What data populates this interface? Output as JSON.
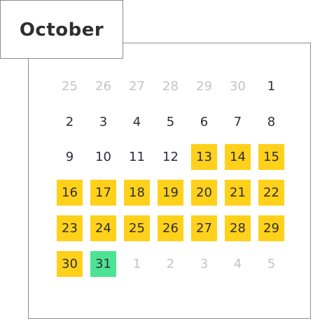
{
  "calendar": {
    "month": "October",
    "colors": {
      "range_highlight": "#ffd11a",
      "today_highlight": "#4de394",
      "outside_text": "#c4c4c8",
      "text": "#2e2e3a"
    },
    "weeks": [
      [
        {
          "day": "25",
          "state": "outside"
        },
        {
          "day": "26",
          "state": "outside"
        },
        {
          "day": "27",
          "state": "outside"
        },
        {
          "day": "28",
          "state": "outside"
        },
        {
          "day": "29",
          "state": "outside"
        },
        {
          "day": "30",
          "state": "outside"
        },
        {
          "day": "1",
          "state": "normal"
        }
      ],
      [
        {
          "day": "2",
          "state": "normal"
        },
        {
          "day": "3",
          "state": "normal"
        },
        {
          "day": "4",
          "state": "normal"
        },
        {
          "day": "5",
          "state": "normal"
        },
        {
          "day": "6",
          "state": "normal"
        },
        {
          "day": "7",
          "state": "normal"
        },
        {
          "day": "8",
          "state": "normal"
        }
      ],
      [
        {
          "day": "9",
          "state": "normal"
        },
        {
          "day": "10",
          "state": "normal"
        },
        {
          "day": "11",
          "state": "normal"
        },
        {
          "day": "12",
          "state": "normal"
        },
        {
          "day": "13",
          "state": "range"
        },
        {
          "day": "14",
          "state": "range"
        },
        {
          "day": "15",
          "state": "range"
        }
      ],
      [
        {
          "day": "16",
          "state": "range"
        },
        {
          "day": "17",
          "state": "range"
        },
        {
          "day": "18",
          "state": "range"
        },
        {
          "day": "19",
          "state": "range"
        },
        {
          "day": "20",
          "state": "range"
        },
        {
          "day": "21",
          "state": "range"
        },
        {
          "day": "22",
          "state": "range"
        }
      ],
      [
        {
          "day": "23",
          "state": "range"
        },
        {
          "day": "24",
          "state": "range"
        },
        {
          "day": "25",
          "state": "range"
        },
        {
          "day": "26",
          "state": "range"
        },
        {
          "day": "27",
          "state": "range"
        },
        {
          "day": "28",
          "state": "range"
        },
        {
          "day": "29",
          "state": "range"
        }
      ],
      [
        {
          "day": "30",
          "state": "range"
        },
        {
          "day": "31",
          "state": "today"
        },
        {
          "day": "1",
          "state": "outside"
        },
        {
          "day": "2",
          "state": "outside"
        },
        {
          "day": "3",
          "state": "outside"
        },
        {
          "day": "4",
          "state": "outside"
        },
        {
          "day": "5",
          "state": "outside"
        }
      ]
    ]
  }
}
